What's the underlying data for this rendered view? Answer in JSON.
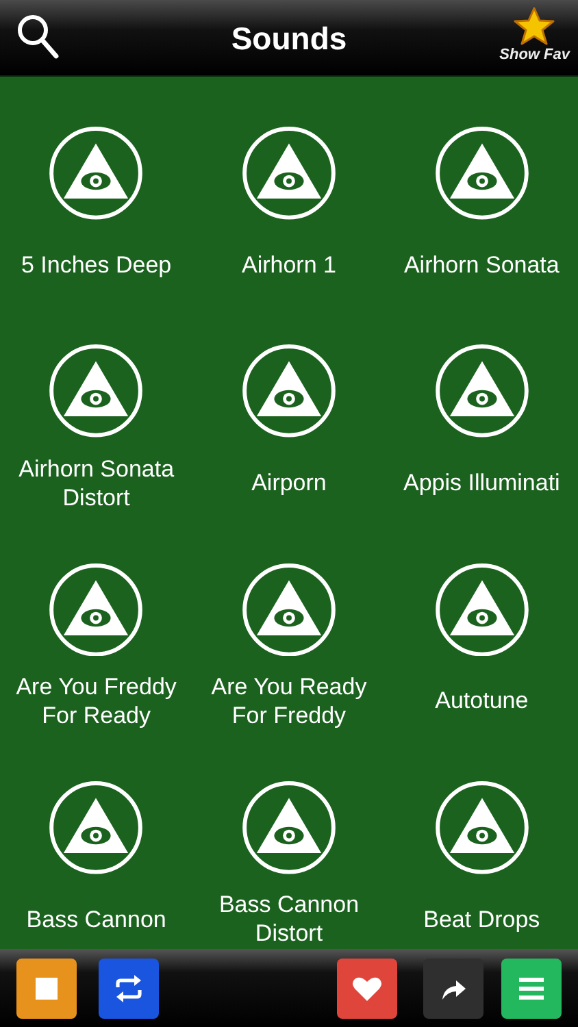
{
  "header": {
    "title": "Sounds",
    "fav_label": "Show Fav"
  },
  "sounds": [
    {
      "label": "5 Inches Deep"
    },
    {
      "label": "Airhorn 1"
    },
    {
      "label": "Airhorn Sonata"
    },
    {
      "label": "Airhorn Sonata Distort"
    },
    {
      "label": "Airporn"
    },
    {
      "label": "Appis Illuminati"
    },
    {
      "label": "Are You Freddy For Ready"
    },
    {
      "label": "Are You Ready For Freddy"
    },
    {
      "label": "Autotune"
    },
    {
      "label": "Bass Cannon"
    },
    {
      "label": "Bass Cannon Distort"
    },
    {
      "label": "Beat Drops"
    }
  ],
  "toolbar": [
    {
      "kind": "stop"
    },
    {
      "kind": "repeat"
    },
    {
      "kind": "spacer"
    },
    {
      "kind": "favorite"
    },
    {
      "kind": "share"
    },
    {
      "kind": "menu"
    }
  ]
}
